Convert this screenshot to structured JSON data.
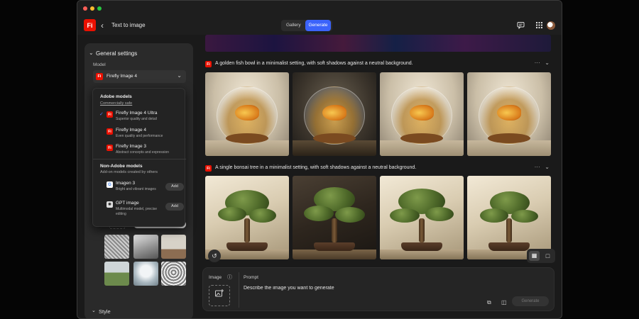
{
  "titlebar": {
    "logo_text": "Fi",
    "back_glyph": "‹",
    "title": "Text to image",
    "tabs": [
      {
        "label": "Gallery",
        "active": false
      },
      {
        "label": "Generate",
        "active": true
      }
    ],
    "icons": [
      "feedback-icon",
      "apps-grid-icon",
      "avatar"
    ]
  },
  "panel": {
    "section_title": "General settings",
    "model_label": "Model",
    "selected_model": "Firefly Image 4",
    "browse_label": "Browse gallery",
    "style_title": "Style"
  },
  "dropdown": {
    "adobe_title": "Adobe models",
    "adobe_sub": "Commercially safe",
    "adobe_models": [
      {
        "name": "Firefly Image 4 Ultra",
        "desc": "Superior quality and detail",
        "selected": true
      },
      {
        "name": "Firefly Image 4",
        "desc": "Even quality and performance",
        "selected": false
      },
      {
        "name": "Firefly Image 3",
        "desc": "Abstract concepts and expression",
        "selected": false
      }
    ],
    "partner_title": "Non-Adobe models",
    "partner_sub": "Add-on models created by others",
    "partner_models": [
      {
        "name": "Imagen 3",
        "desc": "Bright and vibrant images",
        "action": "Add",
        "icon": "google-icon"
      },
      {
        "name": "GPT image",
        "desc": "Multimodal model, precise editing",
        "action": "Add",
        "icon": "openai-icon"
      }
    ]
  },
  "generations": [
    {
      "prompt": "A golden fish bowl in a minimalist setting, with soft shadows against a neutral background.",
      "image_count": 4
    },
    {
      "prompt": "A single bonsai tree in a minimalist setting, with soft shadows against a neutral background.",
      "image_count": 4
    }
  ],
  "composer": {
    "image_label": "Image",
    "prompt_label": "Prompt",
    "prompt_placeholder": "Describe the image you want to generate",
    "generate_label": "Generate"
  },
  "colors": {
    "accent": "#3b63fb",
    "brand": "#eb1000",
    "background": "#1a1a1a",
    "panel": "#2a2a2a"
  }
}
